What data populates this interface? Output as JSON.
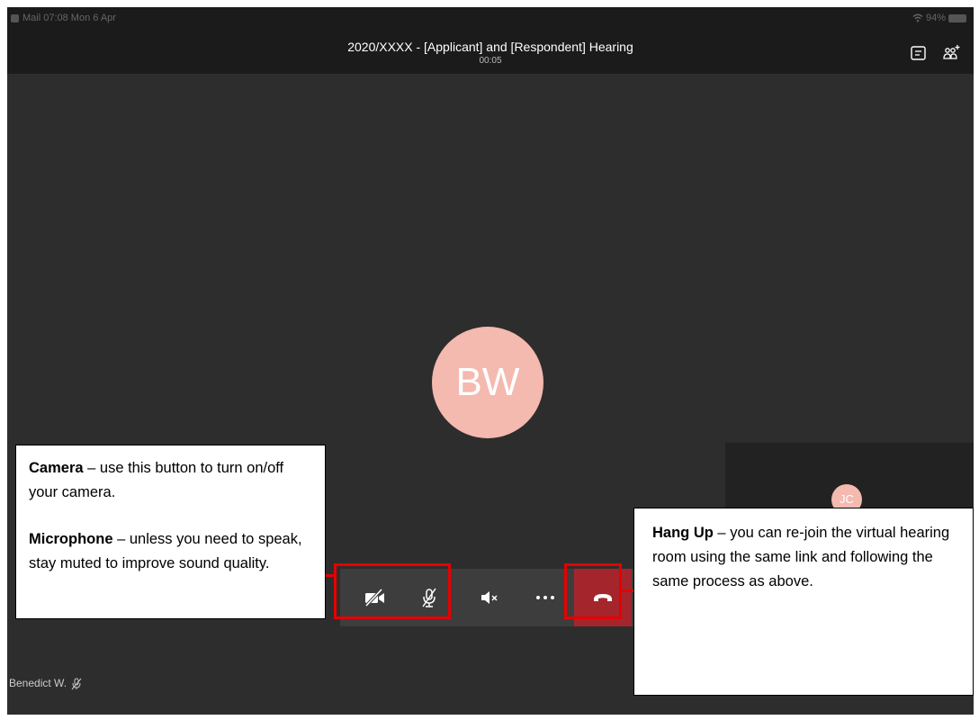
{
  "status_bar": {
    "left_text": "Mail  07:08  Mon 6 Apr",
    "battery": "94%"
  },
  "header": {
    "title": "2020/XXXX - [Applicant] and [Respondent] Hearing",
    "timer": "00:05"
  },
  "participants": {
    "main_initials": "BW",
    "side_initials": "JC",
    "self_name": "Benedict W."
  },
  "callouts": {
    "camera_title": "Camera",
    "camera_text": " – use this button to turn on/off your camera.",
    "mic_title": "Microphone",
    "mic_text": " – unless you need to speak, stay muted to improve sound quality.",
    "hangup_title": "Hang Up",
    "hangup_text": " – you can re-join the virtual hearing room using the same link and following the same process as above."
  },
  "icons": {
    "camera": "camera-off-icon",
    "mic": "mic-off-icon",
    "speaker": "speaker-muted-icon",
    "more": "more-icon",
    "hangup": "hang-up-icon",
    "chat": "chat-icon",
    "people": "add-people-icon"
  },
  "colors": {
    "hangup": "#a4262c",
    "avatar": "#f4b9af",
    "highlight": "#e60000"
  }
}
